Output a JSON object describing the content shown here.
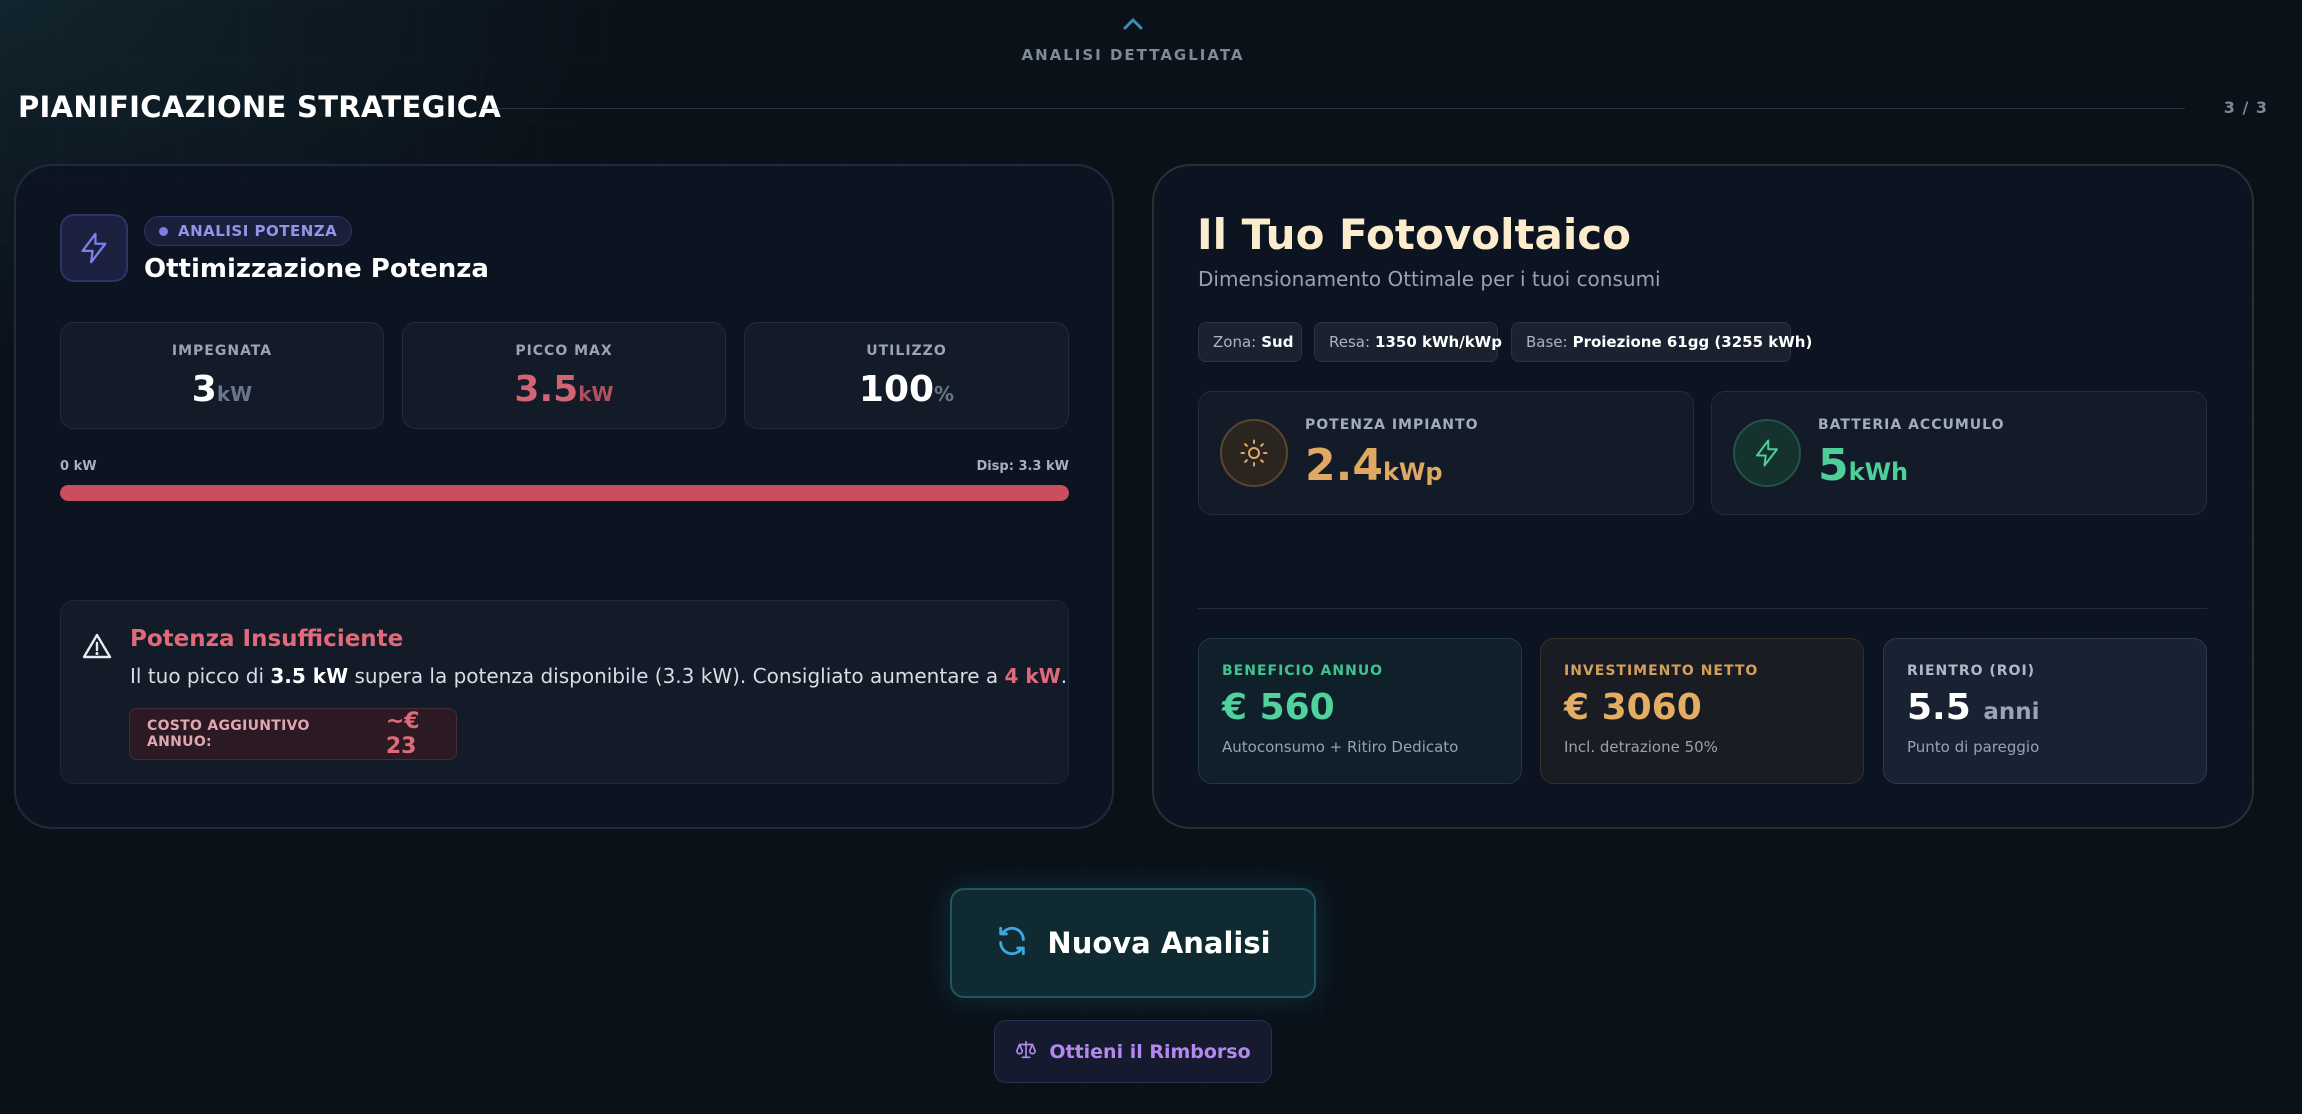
{
  "nav": {
    "label": "ANALISI DETTAGLIATA",
    "icon": "chevron-up-icon"
  },
  "section": {
    "title": "PIANIFICAZIONE STRATEGICA",
    "counter": "3 / 3"
  },
  "power": {
    "icon": "lightning-icon",
    "badge": "ANALISI POTENZA",
    "title": "Ottimizzazione Potenza",
    "stats": [
      {
        "label": "IMPEGNATA",
        "value": "3",
        "unit": "kW"
      },
      {
        "label": "PICCO MAX",
        "value": "3.5",
        "unit": "kW"
      },
      {
        "label": "UTILIZZO",
        "value": "100",
        "unit": "%"
      }
    ],
    "bar": {
      "left_label": "0 kW",
      "right_label": "Disp: 3.3 kW",
      "fill_fraction": 1.0,
      "color": "#c94f5f"
    },
    "warning": {
      "icon": "warning-triangle-icon",
      "title": "Potenza Insufficiente",
      "text_1": "Il tuo picco di ",
      "peak": "3.5 kW",
      "text_2": " supera la potenza disponibile (3.3 kW). Consigliato aumentare a ",
      "recommended": "4 kW",
      "text_3": ".",
      "cost_label": "COSTO AGGIUNTIVO ANNUO:",
      "cost_value": "~€ 23"
    }
  },
  "pv": {
    "title": "Il Tuo Fotovoltaico",
    "subtitle": "Dimensionamento Ottimale per i tuoi consumi",
    "chips": [
      {
        "key": "Zona:",
        "value": "Sud"
      },
      {
        "key": "Resa:",
        "value": "1350 kWh/kWp"
      },
      {
        "key": "Base:",
        "value": "Proiezione 61gg (3255 kWh)"
      }
    ],
    "potenza": {
      "icon": "sun-icon",
      "label": "POTENZA IMPIANTO",
      "value": "2.4",
      "unit": "kWp"
    },
    "batteria": {
      "icon": "lightning-icon",
      "label": "BATTERIA ACCUMULO",
      "value": "5",
      "unit": "kWh"
    },
    "kpis": [
      {
        "label": "BENEFICIO ANNUO",
        "value": "€ 560",
        "unit": "",
        "sub": "Autoconsumo + Ritiro Dedicato"
      },
      {
        "label": "INVESTIMENTO NETTO",
        "value": "€ 3060",
        "unit": "",
        "sub": "Incl. detrazione 50%"
      },
      {
        "label": "RIENTRO (ROI)",
        "value": "5.5",
        "unit": "anni",
        "sub": "Punto di pareggio"
      }
    ]
  },
  "actions": {
    "primary": {
      "label": "Nuova Analisi",
      "icon": "refresh-icon"
    },
    "secondary": {
      "label": "Ottieni il Rimborso",
      "icon": "scale-icon"
    }
  },
  "colors": {
    "accent_red": "#e06a7a",
    "accent_green": "#4fd29c",
    "accent_gold": "#e4ad64",
    "accent_purple": "#b389ef"
  }
}
